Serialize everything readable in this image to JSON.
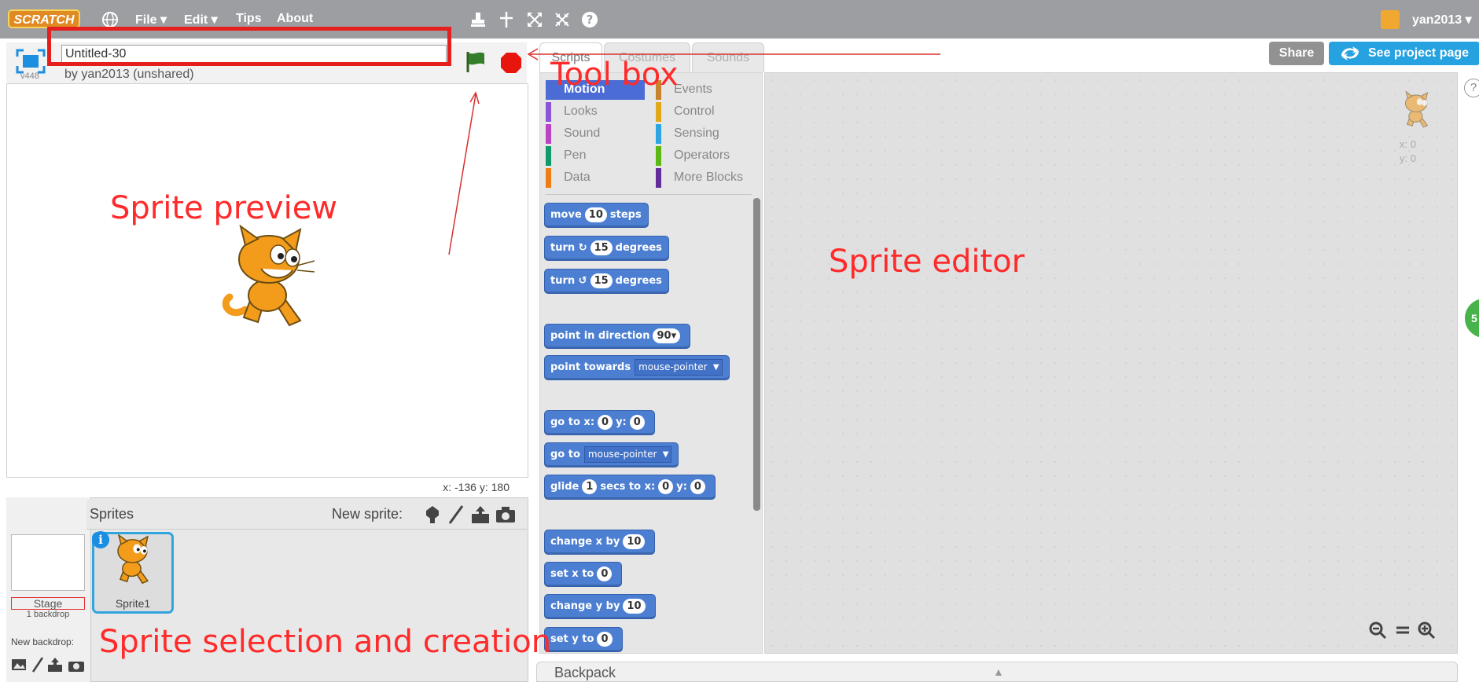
{
  "menubar": {
    "logo": "SCRATCH",
    "file": "File ▾",
    "edit": "Edit ▾",
    "tips": "Tips",
    "about": "About",
    "user": "yan2013 ▾"
  },
  "project": {
    "title": "Untitled-30",
    "byline": "by yan2013 (unshared)",
    "version": "v448"
  },
  "stage": {
    "coords_label": "x: -136  y: 180"
  },
  "tabs": [
    "Scripts",
    "Costumes",
    "Sounds"
  ],
  "header_buttons": {
    "share": "Share",
    "see_project": "See project page"
  },
  "categories": [
    {
      "label": "Motion",
      "color": "#4a6cd4"
    },
    {
      "label": "Events",
      "color": "#c88330"
    },
    {
      "label": "Looks",
      "color": "#8a55d7"
    },
    {
      "label": "Control",
      "color": "#e1a91a"
    },
    {
      "label": "Sound",
      "color": "#bb42c3"
    },
    {
      "label": "Sensing",
      "color": "#2ca5e2"
    },
    {
      "label": "Pen",
      "color": "#0e9a6c"
    },
    {
      "label": "Operators",
      "color": "#5cb712"
    },
    {
      "label": "Data",
      "color": "#ee7d16"
    },
    {
      "label": "More Blocks",
      "color": "#632d99"
    }
  ],
  "blocks": {
    "move": {
      "pre": "move",
      "num": "10",
      "post": "steps"
    },
    "turn_cw": {
      "pre": "turn ↻",
      "num": "15",
      "post": "degrees"
    },
    "turn_ccw": {
      "pre": "turn ↺",
      "num": "15",
      "post": "degrees"
    },
    "point_dir": {
      "pre": "point in direction",
      "num": "90▾"
    },
    "point_towards": {
      "pre": "point towards",
      "drop": "mouse-pointer"
    },
    "goto_xy": {
      "pre": "go to x:",
      "x": "0",
      "ylabel": "y:",
      "y": "0"
    },
    "goto": {
      "pre": "go to",
      "drop": "mouse-pointer"
    },
    "glide": {
      "pre": "glide",
      "secs": "1",
      "mid": "secs to x:",
      "x": "0",
      "ylabel": "y:",
      "y": "0"
    },
    "change_x": {
      "pre": "change x by",
      "num": "10"
    },
    "set_x": {
      "pre": "set x to",
      "num": "0"
    },
    "change_y": {
      "pre": "change y by",
      "num": "10"
    },
    "set_y": {
      "pre": "set y to",
      "num": "0"
    }
  },
  "sprite_pane": {
    "header": "Sprites",
    "new_sprite": "New sprite:",
    "stage_label": "Stage",
    "stage_sub": "1 backdrop",
    "new_backdrop": "New backdrop:",
    "sprite1": "Sprite1"
  },
  "scripts_area": {
    "x_readout": "x: 0",
    "y_readout": "y: 0",
    "green_badge": "5"
  },
  "backpack": {
    "label": "Backpack"
  },
  "annotations": {
    "toolbox": "Tool box",
    "sprite_preview": "Sprite preview",
    "sprite_editor": "Sprite editor",
    "sprite_selection": "Sprite selection and creation"
  },
  "icons": {
    "globe": "globe-icon",
    "duplicate": "stamp-icon",
    "delete": "scissors-icon",
    "grow": "grow-icon",
    "shrink": "shrink-icon",
    "help": "help-icon"
  }
}
